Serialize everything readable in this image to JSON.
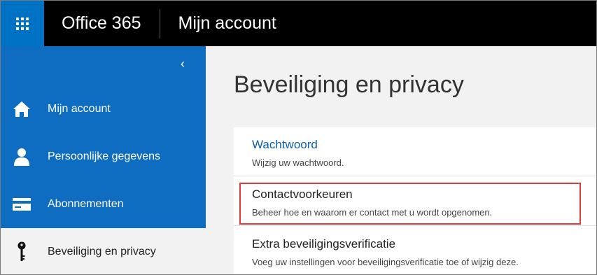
{
  "header": {
    "brand": "Office 365",
    "app_title": "Mijn account"
  },
  "sidebar": {
    "collapse_glyph": "‹",
    "items": [
      {
        "label": "Mijn account",
        "icon": "home-icon"
      },
      {
        "label": "Persoonlijke gegevens",
        "icon": "person-icon"
      },
      {
        "label": "Abonnementen",
        "icon": "card-icon"
      },
      {
        "label": "Beveiliging en privacy",
        "icon": "key-icon",
        "active": true
      }
    ]
  },
  "main": {
    "title": "Beveiliging en privacy",
    "rows": [
      {
        "title": "Wachtwoord",
        "desc": "Wijzig uw wachtwoord."
      },
      {
        "title": "Contactvoorkeuren",
        "desc": "Beheer hoe en waarom er contact met u wordt opgenomen."
      },
      {
        "title": "Extra beveiligingsverificatie",
        "desc": "Voeg uw instellingen voor beveiligingsverificatie toe of wijzig deze."
      }
    ]
  },
  "colors": {
    "topbar": "#000000",
    "waffle": "#0072c6",
    "sidebar": "#0e6cc1",
    "link": "#0a5fae",
    "highlight": "#e03a3a"
  }
}
